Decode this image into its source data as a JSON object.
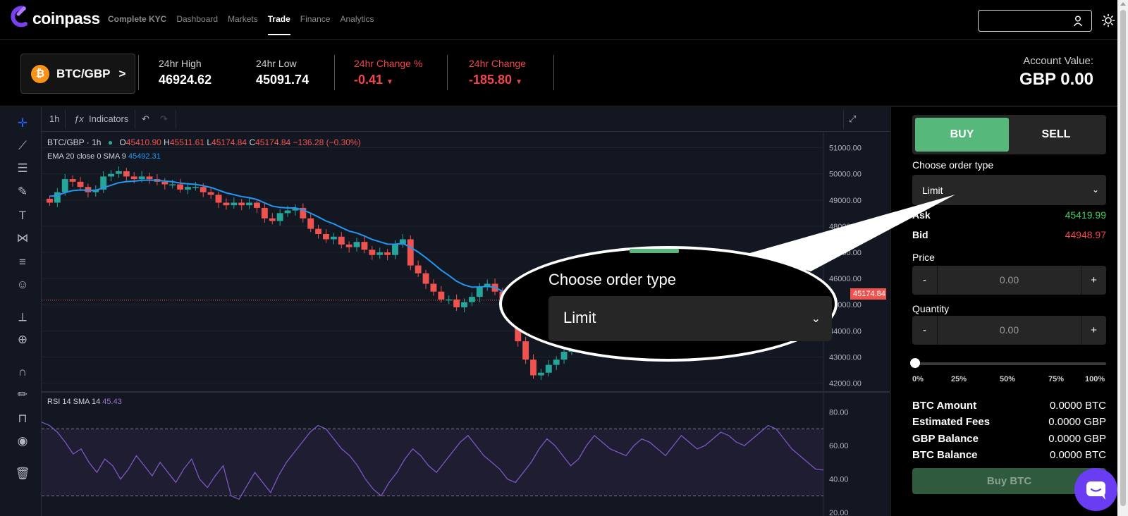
{
  "app": {
    "brand": "coinpass"
  },
  "nav": {
    "items": [
      {
        "label": "Complete KYC"
      },
      {
        "label": "Dashboard"
      },
      {
        "label": "Markets"
      },
      {
        "label": "Trade"
      },
      {
        "label": "Finance"
      },
      {
        "label": "Analytics"
      }
    ],
    "active": "Trade",
    "search_value": ""
  },
  "ticker": {
    "pair": "BTC/GBP",
    "chevron": ">",
    "coin_symbol": "₿",
    "high_label": "24hr High",
    "high_value": "46924.62",
    "low_label": "24hr Low",
    "low_value": "45091.74",
    "change_pct_label": "24hr Change %",
    "change_pct_value": "-0.41",
    "change_label": "24hr Change",
    "change_value": "-185.80",
    "account_label": "Account Value:",
    "account_value": "GBP 0.00"
  },
  "chart": {
    "interval": "1h",
    "indicators_label": "Indicators",
    "symbol": "BTC/GBP · 1h",
    "ohlc": {
      "o_label": "O",
      "o": "45410.90",
      "h_label": "H",
      "h": "45511.61",
      "l_label": "L",
      "l": "45174.84",
      "c_label": "C",
      "c": "45174.84",
      "change": "−136.28 (−0.30%)"
    },
    "ema_label": "EMA 20 close 0 SMA 9",
    "ema_value": "45492.31",
    "rsi_label": "RSI 14 SMA 14",
    "rsi_value": "45.43",
    "last_price_tag": "45174.84",
    "price_axis": [
      "51000.00",
      "50000.00",
      "49000.00",
      "48000.00",
      "47000.00",
      "46000.00",
      "45000.00",
      "44000.00",
      "43000.00",
      "42000.00"
    ],
    "rsi_axis": [
      "80.00",
      "60.00",
      "40.00",
      "20.00"
    ],
    "colors": {
      "up": "#26a69a",
      "down": "#ef5350",
      "ema": "#2196f3",
      "rsi": "#7e57c2"
    }
  },
  "chart_data": {
    "type": "candlestick",
    "y_range": [
      41800,
      51500
    ],
    "close_series": [
      48900,
      49300,
      49800,
      49700,
      49500,
      49300,
      49400,
      49900,
      50000,
      50100,
      49900,
      49800,
      49900,
      49800,
      49700,
      49600,
      49600,
      49400,
      49500,
      49500,
      49300,
      49200,
      48900,
      48800,
      48900,
      48800,
      48900,
      48700,
      48300,
      48200,
      48500,
      48600,
      48700,
      48300,
      47900,
      47700,
      47500,
      47600,
      47300,
      47200,
      47400,
      47100,
      46900,
      47000,
      46900,
      47300,
      47500,
      46500,
      46200,
      45800,
      45500,
      45200,
      45200,
      44900,
      45100,
      45300,
      45700,
      45800,
      45500,
      44800,
      44400,
      43600,
      42900,
      42300,
      42400,
      42700,
      42900,
      43200,
      43500,
      43700,
      43800,
      43900,
      44000,
      43900,
      44000,
      44100,
      43900,
      43800,
      44000,
      44100,
      44300,
      44400,
      44600,
      44900,
      45100,
      45200,
      45300,
      45400,
      45500,
      45600,
      45400,
      45600,
      45500,
      45700,
      45600,
      45500,
      45400,
      45300,
      45200,
      45174
    ],
    "rsi_series": [
      74,
      72,
      68,
      62,
      55,
      58,
      50,
      44,
      52,
      48,
      40,
      46,
      54,
      48,
      42,
      50,
      44,
      38,
      46,
      52,
      40,
      35,
      42,
      48,
      30,
      28,
      36,
      44,
      38,
      32,
      42,
      50,
      56,
      62,
      68,
      72,
      70,
      64,
      58,
      54,
      48,
      40,
      34,
      30,
      38,
      44,
      52,
      58,
      54,
      48,
      44,
      50,
      56,
      62,
      66,
      60,
      54,
      50,
      46,
      40,
      38,
      44,
      50,
      58,
      64,
      60,
      54,
      48,
      52,
      60,
      66,
      62,
      58,
      56,
      54,
      60,
      64,
      62,
      58,
      54,
      60,
      66,
      62,
      58,
      60,
      64,
      68,
      66,
      62,
      60,
      64,
      68,
      72,
      70,
      64,
      58,
      54,
      50,
      46,
      45.43
    ]
  },
  "panel": {
    "buy_label": "BUY",
    "sell_label": "SELL",
    "order_type_label": "Choose order type",
    "order_type_value": "Limit",
    "ask_label": "Ask",
    "ask_value": "45419.99",
    "bid_label": "Bid",
    "bid_value": "44948.97",
    "price_label": "Price",
    "price_value": "0.00",
    "quantity_label": "Quantity",
    "quantity_value": "0.00",
    "minus": "-",
    "plus": "+",
    "slider_marks": [
      "0%",
      "25%",
      "50%",
      "75%",
      "100%"
    ],
    "slider_value_pct": 0,
    "btc_amount_label": "BTC Amount",
    "btc_amount_value": "0.0000 BTC",
    "fees_label": "Estimated Fees",
    "fees_value": "0.0000 GBP",
    "gbp_balance_label": "GBP Balance",
    "gbp_balance_value": "0.0000 GBP",
    "btc_balance_label": "BTC Balance",
    "btc_balance_value": "0.0000 BTC",
    "buy_btc_label": "Buy BTC",
    "colors": {
      "buy": "#56b97b",
      "ask": "#3fcf5a",
      "bid": "#f0454a"
    }
  },
  "callout": {
    "label": "Choose order type",
    "value": "Limit"
  }
}
